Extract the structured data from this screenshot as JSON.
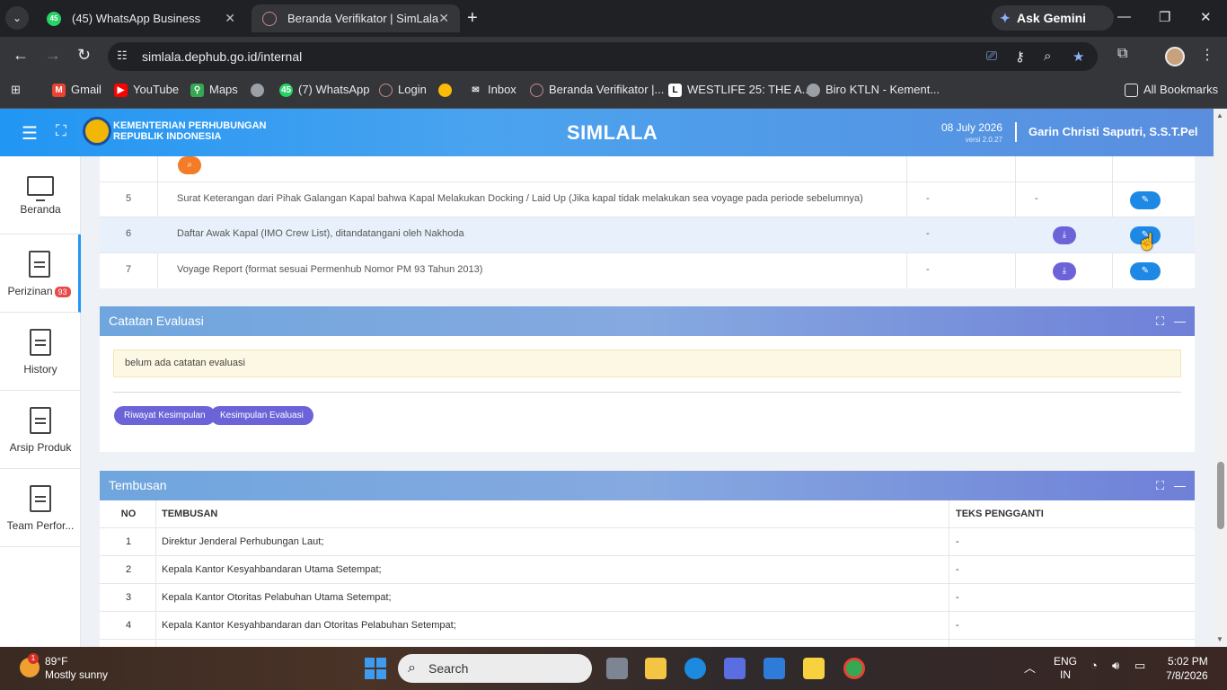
{
  "browser": {
    "tabs": [
      {
        "title": "(45) WhatsApp Business",
        "badge": "45"
      },
      {
        "title": "Beranda Verifikator | SimLala"
      }
    ],
    "gemini_label": "Ask Gemini",
    "url": "simlala.dephub.go.id/internal",
    "bookmarks": [
      {
        "label": "Gmail",
        "color": "#ea4335"
      },
      {
        "label": "YouTube",
        "color": "#ff0000"
      },
      {
        "label": "Maps",
        "color": "#34a853"
      },
      {
        "label": "",
        "color": "#9aa0a6"
      },
      {
        "label": "(7) WhatsApp",
        "color": "#25d366",
        "badge": "45"
      },
      {
        "label": "Login",
        "color": "#c58a8a"
      },
      {
        "label": "",
        "color": "#fbbc05"
      },
      {
        "label": "Inbox",
        "color": "#9aa0a6"
      },
      {
        "label": "Beranda Verifikator |...",
        "color": "#c58a8a"
      },
      {
        "label": "WESTLIFE 25: THE A...",
        "color": "#ffffff"
      },
      {
        "label": "Biro KTLN - Kement...",
        "color": "#9aa0a6"
      }
    ],
    "all_bookmarks": "All Bookmarks"
  },
  "app": {
    "ministry_line1": "KEMENTERIAN PERHUBUNGAN",
    "ministry_line2": "REPUBLIK INDONESIA",
    "title": "SIMLALA",
    "date": "08 July 2026",
    "version": "versi 2.0.27",
    "user": "Garin Christi Saputri, S.S.T.Pel"
  },
  "sidebar": [
    {
      "label": "Beranda",
      "icon": "monitor-icon"
    },
    {
      "label": "Perizinan",
      "icon": "document-icon",
      "badge": "93"
    },
    {
      "label": "History",
      "icon": "document-icon"
    },
    {
      "label": "Arsip Produk",
      "icon": "document-icon"
    },
    {
      "label": "Team Perfor...",
      "icon": "document-icon"
    }
  ],
  "documents": {
    "rows": [
      {
        "no": "5",
        "name": "Surat Keterangan dari Pihak Galangan Kapal bahwa Kapal Melakukan Docking / Laid Up (Jika kapal tidak melakukan sea voyage pada periode sebelumnya)",
        "col_a": "-",
        "col_b": "-"
      },
      {
        "no": "6",
        "name": "Daftar Awak Kapal (IMO Crew List), ditandatangani oleh Nakhoda",
        "col_a": "-",
        "col_b": ""
      },
      {
        "no": "7",
        "name": "Voyage Report (format sesuai Permenhub Nomor PM 93 Tahun 2013)",
        "col_a": "-",
        "col_b": ""
      }
    ]
  },
  "evaluasi": {
    "title": "Catatan Evaluasi",
    "note": "belum ada catatan evaluasi",
    "btn_riwayat": "Riwayat Kesimpulan",
    "btn_kesimpulan": "Kesimpulan Evaluasi"
  },
  "tembusan": {
    "title": "Tembusan",
    "headers": {
      "no": "NO",
      "tembusan": "TEMBUSAN",
      "pengganti": "TEKS PENGGANTI"
    },
    "rows": [
      {
        "no": "1",
        "text": "Direktur Jenderal Perhubungan Laut;",
        "pengganti": "-"
      },
      {
        "no": "2",
        "text": "Kepala Kantor Kesyahbandaran Utama Setempat;",
        "pengganti": "-"
      },
      {
        "no": "3",
        "text": "Kepala Kantor Otoritas Pelabuhan Utama Setempat;",
        "pengganti": "-"
      },
      {
        "no": "4",
        "text": "Kepala Kantor Kesyahbandaran dan Otoritas Pelabuhan Setempat;",
        "pengganti": "-"
      }
    ]
  },
  "taskbar": {
    "weather_temp": "89°F",
    "weather_desc": "Mostly sunny",
    "weather_badge": "1",
    "search": "Search",
    "lang1": "ENG",
    "lang2": "IN",
    "time": "5:02 PM",
    "date": "7/8/2026"
  }
}
